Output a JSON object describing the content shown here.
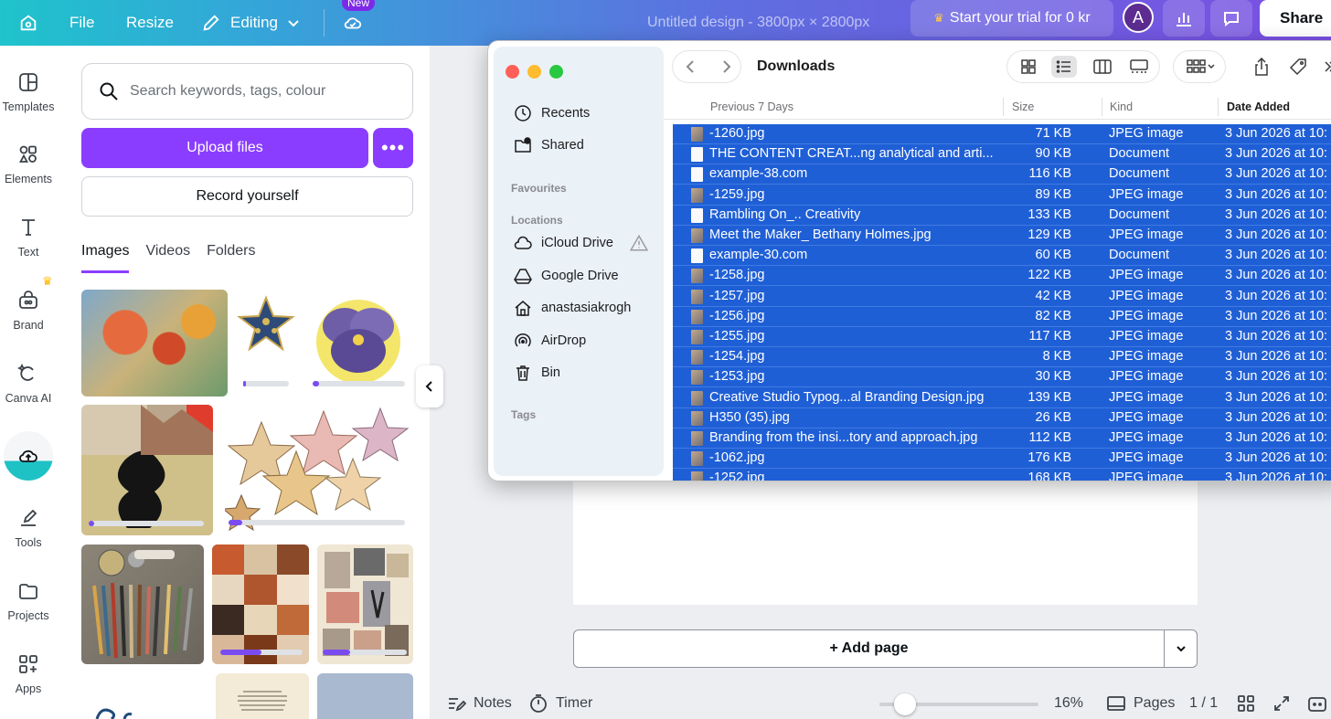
{
  "topbar": {
    "file_label": "File",
    "resize_label": "Resize",
    "editing_label": "Editing",
    "new_badge": "New",
    "design_title": "Untitled design - 3800px × 2800px",
    "trial_label": "Start your trial for 0 kr",
    "avatar_initial": "A",
    "share_label": "Share"
  },
  "rail": {
    "items": [
      {
        "label": "Templates",
        "icon": "templates-icon"
      },
      {
        "label": "Elements",
        "icon": "elements-icon"
      },
      {
        "label": "Text",
        "icon": "text-icon"
      },
      {
        "label": "Brand",
        "icon": "brand-icon"
      },
      {
        "label": "Canva AI",
        "icon": "canva-ai-icon"
      },
      {
        "label": "",
        "icon": "uploads-icon"
      },
      {
        "label": "Tools",
        "icon": "tools-icon"
      },
      {
        "label": "Projects",
        "icon": "projects-icon"
      },
      {
        "label": "Apps",
        "icon": "apps-icon"
      }
    ]
  },
  "panel": {
    "search_placeholder": "Search keywords, tags, colour",
    "upload_label": "Upload files",
    "more_label": "•••",
    "record_label": "Record yourself",
    "tabs": [
      "Images",
      "Videos",
      "Folders"
    ],
    "progress": {
      "star_small": 0.05,
      "pansy": 0.07,
      "collage": 0.05,
      "stars_group": 0.08,
      "moodboard_a": 0.5,
      "moodboard_b": 0.33
    }
  },
  "canvas": {
    "add_page_label": "+ Add page"
  },
  "bottombar": {
    "notes_label": "Notes",
    "timer_label": "Timer",
    "zoom_value": 16,
    "zoom_label": "16%",
    "pages_label": "Pages",
    "page_count": "1 / 1"
  },
  "finder": {
    "title": "Downloads",
    "sidebar": {
      "recents": "Recents",
      "shared": "Shared",
      "favourites_heading": "Favourites",
      "locations_heading": "Locations",
      "locations": [
        "iCloud Drive",
        "Google Drive",
        "anastasiakrogh",
        "AirDrop",
        "Bin"
      ],
      "tags_heading": "Tags"
    },
    "columns": {
      "name": "Previous 7 Days",
      "size": "Size",
      "kind": "Kind",
      "date": "Date Added"
    },
    "rows": [
      {
        "name": "-1260.jpg",
        "size": "71 KB",
        "kind": "JPEG image",
        "date": "3 Jun 2026 at 10:",
        "type": "img"
      },
      {
        "name": "THE CONTENT CREAT...ng analytical and arti...",
        "size": "90 KB",
        "kind": "Document",
        "date": "3 Jun 2026 at 10:",
        "type": "doc"
      },
      {
        "name": "example-38.com",
        "size": "116 KB",
        "kind": "Document",
        "date": "3 Jun 2026 at 10:",
        "type": "doc"
      },
      {
        "name": "-1259.jpg",
        "size": "89 KB",
        "kind": "JPEG image",
        "date": "3 Jun 2026 at 10:",
        "type": "img"
      },
      {
        "name": "Rambling On_.. Creativity",
        "size": "133 KB",
        "kind": "Document",
        "date": "3 Jun 2026 at 10:",
        "type": "doc"
      },
      {
        "name": "Meet the Maker_ Bethany Holmes.jpg",
        "size": "129 KB",
        "kind": "JPEG image",
        "date": "3 Jun 2026 at 10:",
        "type": "img"
      },
      {
        "name": "example-30.com",
        "size": "60 KB",
        "kind": "Document",
        "date": "3 Jun 2026 at 10:",
        "type": "doc"
      },
      {
        "name": "-1258.jpg",
        "size": "122 KB",
        "kind": "JPEG image",
        "date": "3 Jun 2026 at 10:",
        "type": "img"
      },
      {
        "name": "-1257.jpg",
        "size": "42 KB",
        "kind": "JPEG image",
        "date": "3 Jun 2026 at 10:",
        "type": "img"
      },
      {
        "name": "-1256.jpg",
        "size": "82 KB",
        "kind": "JPEG image",
        "date": "3 Jun 2026 at 10:",
        "type": "img"
      },
      {
        "name": "-1255.jpg",
        "size": "117 KB",
        "kind": "JPEG image",
        "date": "3 Jun 2026 at 10:",
        "type": "img"
      },
      {
        "name": "-1254.jpg",
        "size": "8 KB",
        "kind": "JPEG image",
        "date": "3 Jun 2026 at 10:",
        "type": "img"
      },
      {
        "name": "-1253.jpg",
        "size": "30 KB",
        "kind": "JPEG image",
        "date": "3 Jun 2026 at 10:",
        "type": "img"
      },
      {
        "name": "Creative Studio Typog...al Branding Design.jpg",
        "size": "139 KB",
        "kind": "JPEG image",
        "date": "3 Jun 2026 at 10:",
        "type": "img"
      },
      {
        "name": "H350 (35).jpg",
        "size": "26 KB",
        "kind": "JPEG image",
        "date": "3 Jun 2026 at 10:",
        "type": "img"
      },
      {
        "name": "Branding from the insi...tory and approach.jpg",
        "size": "112 KB",
        "kind": "JPEG image",
        "date": "3 Jun 2026 at 10:",
        "type": "img"
      },
      {
        "name": "-1062.jpg",
        "size": "176 KB",
        "kind": "JPEG image",
        "date": "3 Jun 2026 at 10:",
        "type": "img"
      },
      {
        "name": "-1252.jpg",
        "size": "168 KB",
        "kind": "JPEG image",
        "date": "3 Jun 2026 at 10:",
        "type": "img"
      }
    ],
    "selection_color": "#1f5fd6"
  }
}
